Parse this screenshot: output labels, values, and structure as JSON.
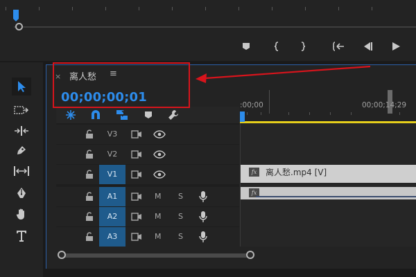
{
  "sequence": {
    "close_label": "×",
    "name": "离人愁",
    "menu_label": "≡",
    "timecode": "00;00;00;01"
  },
  "ruler": {
    "labels": [
      ":00;00",
      "00;00;14;29"
    ]
  },
  "video_tracks": [
    {
      "name": "V3",
      "targeted": false
    },
    {
      "name": "V2",
      "targeted": false
    },
    {
      "name": "V1",
      "targeted": true
    }
  ],
  "audio_tracks": [
    {
      "name": "A1",
      "mute": "M",
      "solo": "S",
      "targeted": true
    },
    {
      "name": "A2",
      "mute": "M",
      "solo": "S",
      "targeted": true
    },
    {
      "name": "A3",
      "mute": "M",
      "solo": "S",
      "targeted": true
    }
  ],
  "clips": {
    "video_label": "离人愁.mp4 [V]",
    "fx_badge": "fx"
  },
  "colors": {
    "accent_blue": "#2d8ceb",
    "track_target": "#1f5b8c",
    "annotation_red": "#d8141c",
    "work_area_yellow": "#e6cf1b"
  },
  "icons": {
    "tools": [
      "selection-arrow-icon",
      "track-select-icon",
      "ripple-edit-icon",
      "razor-icon",
      "slip-icon",
      "pen-icon",
      "hand-icon",
      "type-icon"
    ],
    "transport": [
      "marker-icon",
      "mark-in-icon",
      "mark-out-icon",
      "go-to-in-icon",
      "step-back-icon",
      "play-icon"
    ]
  }
}
